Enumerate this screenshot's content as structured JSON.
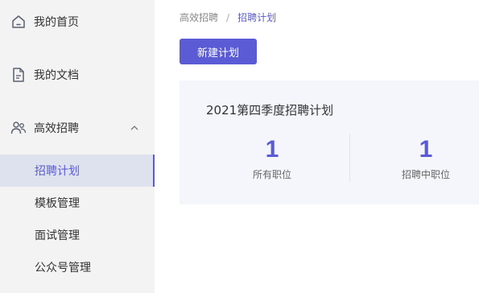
{
  "sidebar": {
    "items": [
      {
        "label": "我的首页",
        "icon": "home-icon"
      },
      {
        "label": "我的文档",
        "icon": "document-icon"
      },
      {
        "label": "高效招聘",
        "icon": "users-icon"
      }
    ],
    "submenu": [
      {
        "label": "招聘计划",
        "active": true
      },
      {
        "label": "模板管理",
        "active": false
      },
      {
        "label": "面试管理",
        "active": false
      },
      {
        "label": "公众号管理",
        "active": false
      }
    ]
  },
  "breadcrumb": {
    "parent": "高效招聘",
    "separator": "/",
    "current": "招聘计划"
  },
  "toolbar": {
    "new_plan_label": "新建计划"
  },
  "plan": {
    "title": "2021第四季度招聘计划",
    "stats": [
      {
        "value": "1",
        "label": "所有职位"
      },
      {
        "value": "1",
        "label": "招聘中职位"
      }
    ]
  },
  "colors": {
    "accent": "#5b5bd6",
    "sidebar_bg": "#f3f3f3",
    "card_bg": "#f5f6fb",
    "active_bg": "#dde2ee"
  }
}
